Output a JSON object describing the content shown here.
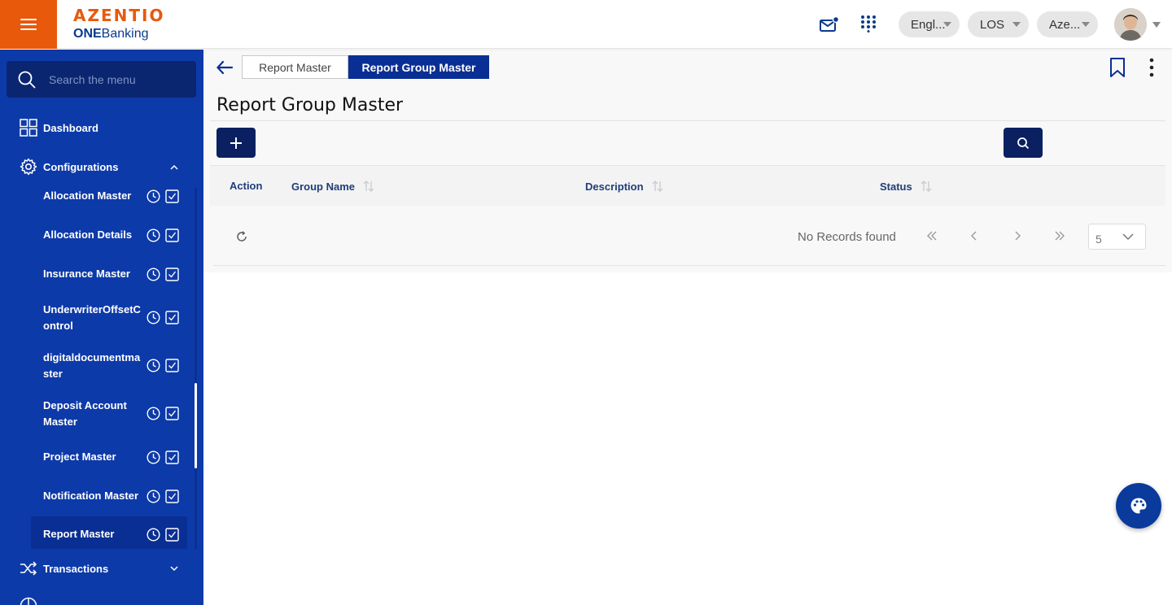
{
  "header": {
    "brand": "AZENTIO",
    "product_bold": "ONE",
    "product_rest": "Banking",
    "language": "Engl...",
    "module": "LOS",
    "entity": "Aze..."
  },
  "sidebar": {
    "search_placeholder": "Search the menu",
    "dashboard": "Dashboard",
    "configurations": "Configurations",
    "items": [
      "Allocation Master",
      "Allocation Details",
      "Insurance Master",
      "UnderwriterOffsetC ontrol",
      "digitaldocumentma ster",
      "Deposit Account Master",
      "Project Master",
      "Notification Master",
      "Report Master"
    ],
    "transactions": "Transactions"
  },
  "tabs": [
    "Report Master",
    "Report Group Master"
  ],
  "page": {
    "title": "Report Group Master"
  },
  "table": {
    "columns": [
      "Action",
      "Group Name",
      "Description",
      "Status"
    ],
    "empty_text": "No Records found",
    "rows_per_page": "5"
  },
  "colors": {
    "brand_orange": "#e8590c",
    "sidebar_blue": "#0d3aa9",
    "primary_dark": "#0a2060",
    "tab_active": "#0a2f94"
  }
}
